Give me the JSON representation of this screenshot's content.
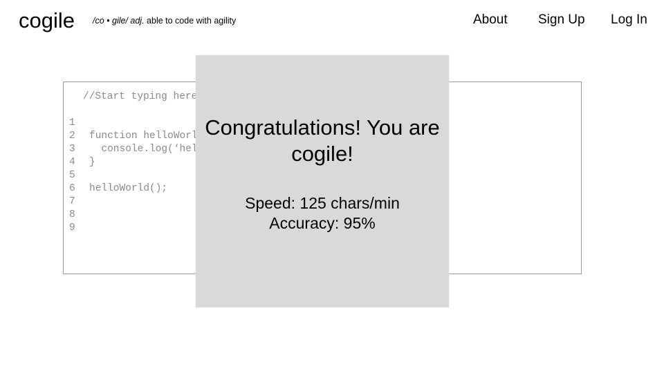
{
  "header": {
    "logo": "cogile",
    "tagline_pronunciation": "/co • gile/ adj.",
    "tagline_definition": " able to code with agility",
    "nav": [
      {
        "label": "About"
      },
      {
        "label": "Sign Up"
      },
      {
        "label": "Log In"
      }
    ]
  },
  "editor": {
    "comment": "//Start typing here",
    "lines": [
      {
        "num": "1",
        "text": "function helloWorld() {"
      },
      {
        "num": "2",
        "text": "  console.log(‘hello’);"
      },
      {
        "num": "3",
        "text": "}"
      },
      {
        "num": "4",
        "text": ""
      },
      {
        "num": "5",
        "text": "helloWorld();"
      },
      {
        "num": "6",
        "text": ""
      },
      {
        "num": "7",
        "text": ""
      },
      {
        "num": "8",
        "text": ""
      },
      {
        "num": "9",
        "text": ""
      }
    ]
  },
  "modal": {
    "title": "Congratulations! You are cogile!",
    "speed": "Speed: 125 chars/min",
    "accuracy": "Accuracy: 95%"
  }
}
